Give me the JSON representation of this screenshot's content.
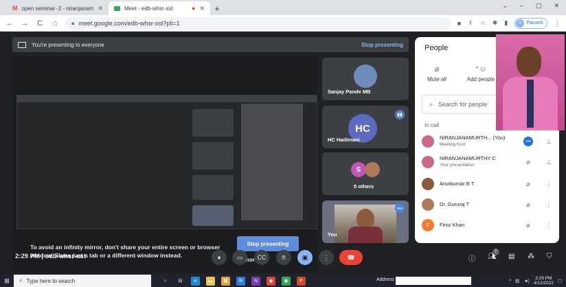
{
  "browser": {
    "tabs": [
      {
        "title": "open seminar -2 - niranjanamurt",
        "icon_color": "#ea4335",
        "active": false
      },
      {
        "title": "Meet - edb-whsr-xst",
        "icon_color": "#34a853",
        "active": true
      }
    ],
    "new_tab": "+",
    "window_controls": [
      "⌄",
      "–",
      "▢",
      "✕"
    ],
    "url": "meet.google.com/edb-whsr-xst?pli=1",
    "profile_initial": "N",
    "profile_status": "Paused"
  },
  "meet": {
    "presenting_banner": "You're presenting to everyone",
    "stop_presenting_link": "Stop presenting",
    "infinity_warning": "To avoid an infinity mirror, don't share your entire screen or browser window. Share just a tab or a different window instead.",
    "stop_presenting_button": "Stop presenting",
    "ignore_button": "Ignore",
    "tiles": [
      {
        "name": "Sanjay Pande MB"
      },
      {
        "name": "HC Hadimani",
        "initials": "HC"
      },
      {
        "name": "5 others",
        "initial": "S"
      },
      {
        "name": "You"
      }
    ],
    "meeting_time": "2:29 PM",
    "meeting_code": "edb-whsr-xst",
    "people_badge": "7"
  },
  "people_panel": {
    "title": "People",
    "mute_all": "Mute all",
    "add_people": "Add people",
    "search_placeholder": "Search for people",
    "in_call_label": "In call",
    "participants": [
      {
        "name": "NIRANJANAMURTH... (You)",
        "sub": "Meeting host",
        "color": "#c96a8a"
      },
      {
        "name": "NIRANJANAMURTHY C",
        "sub": "Your presentation",
        "color": "#c96a8a"
      },
      {
        "name": "Arunkumar B T",
        "sub": "",
        "color": "#8a5a3c"
      },
      {
        "name": "Dr. Gururaj T",
        "sub": "",
        "color": "#b07a5a"
      },
      {
        "name": "Firoz Khan",
        "sub": "",
        "color": "#f4772e",
        "initial": "F"
      }
    ]
  },
  "taskbar": {
    "search_placeholder": "Type here to search",
    "address_label": "Address",
    "time": "2:29 PM",
    "date": "4/12/2022"
  }
}
